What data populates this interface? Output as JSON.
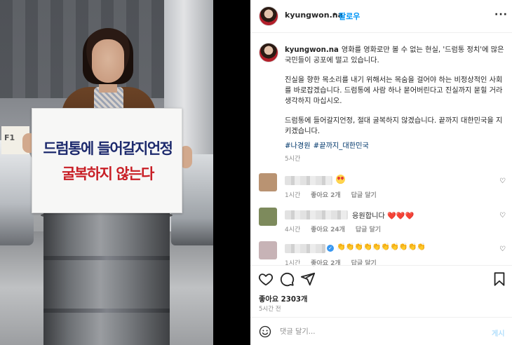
{
  "media": {
    "placard_line1": "드럼통에 들어갈지언정",
    "placard_line2": "굴복하지 않는다",
    "sign_text": "F1"
  },
  "header": {
    "username": "kyungwon.na",
    "separator": "•",
    "follow_label": "팔로우",
    "more_label": "···"
  },
  "caption": {
    "username": "kyungwon.na",
    "paragraphs": [
      "영화를 영화로만 볼 수 없는 현실, '드럼통 정치'에 많은 국민들이 공포에 떨고 있습니다.",
      "진실을 향한 목소리를 내기 위해서는 목숨을 걸어야 하는 비정상적인 사회를 바로잡겠습니다. 드럼통에 사람 하나 묻어버린다고 진실까지 묻힐 거라 생각하지 마십시오.",
      "드럼통에 들어갈지언정, 절대 굴복하지 않겠습니다. 끝까지 대한민국을 지키겠습니다."
    ],
    "hashtags": [
      "#나경원",
      "#끝까지_대한민국"
    ],
    "time": "5시간"
  },
  "comments": [
    {
      "text": "",
      "emoji": "heart-eyes",
      "time": "1시간",
      "likes": "좋아요 2개",
      "reply": "답글 달기",
      "avatar_color": "#b99372"
    },
    {
      "text": "응원합니다 ❤️❤️❤️",
      "emoji": "",
      "time": "4시간",
      "likes": "좋아요 24개",
      "reply": "답글 달기",
      "avatar_color": "#7d8a5c"
    },
    {
      "text": "👏👏👏👏👏👏👏👏👏👏",
      "emoji": "",
      "time": "1시간",
      "likes": "좋아요 2개",
      "reply": "답글 달기",
      "avatar_color": "#c7b3b6",
      "verified": true
    }
  ],
  "actions": {
    "like_icon": "heart-outline-icon",
    "comment_icon": "comment-bubble-icon",
    "share_icon": "paper-plane-icon",
    "save_icon": "bookmark-icon"
  },
  "stats": {
    "likes": "좋아요 2303개",
    "posted": "5시간 전"
  },
  "comment_box": {
    "placeholder": "댓글 달기...",
    "post_label": "게시"
  },
  "colors": {
    "link_blue": "#0095f6",
    "hashtag": "#00376b",
    "muted": "#8e8e8e",
    "post_disabled": "#b2dffc",
    "placard_blue": "#1d2a6d",
    "placard_red": "#c81e25"
  }
}
